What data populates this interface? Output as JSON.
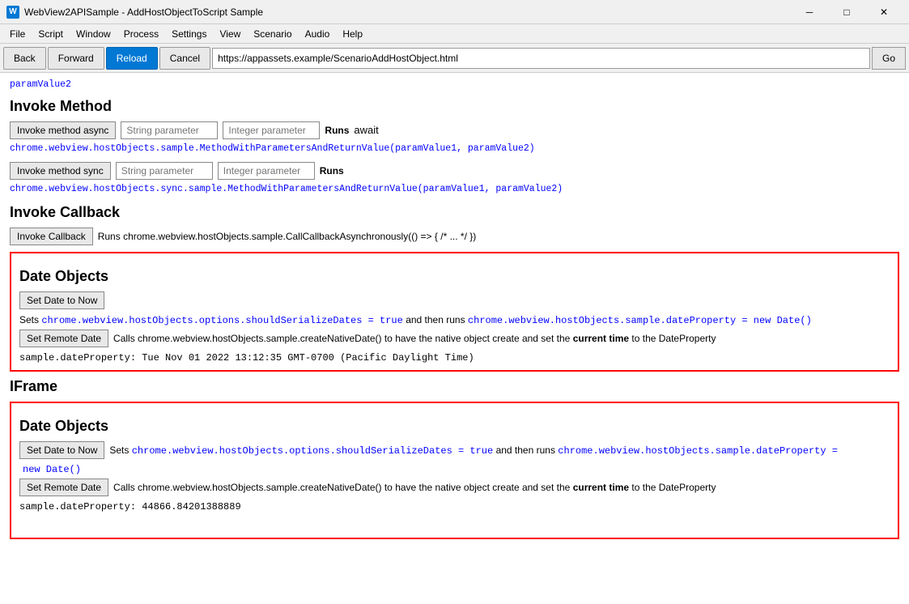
{
  "titlebar": {
    "title": "WebView2APISample - AddHostObjectToScript Sample",
    "icon_label": "W",
    "minimize_label": "─",
    "maximize_label": "□",
    "close_label": "✕"
  },
  "menubar": {
    "items": [
      "File",
      "Script",
      "Window",
      "Process",
      "Settings",
      "View",
      "Scenario",
      "Audio",
      "Help"
    ]
  },
  "toolbar": {
    "back_label": "Back",
    "forward_label": "Forward",
    "reload_label": "Reload",
    "cancel_label": "Cancel",
    "address": "https://appassets.example/ScenarioAddHostObject.html",
    "go_label": "Go"
  },
  "content": {
    "top_cut_text": "paramValue2",
    "invoke_method_title": "Invoke Method",
    "invoke_method_async_btn": "Invoke method async",
    "string_param_placeholder": "String parameter",
    "integer_param_placeholder": "Integer parameter",
    "runs_async_label": "Runs",
    "await_label": "await",
    "async_code": "chrome.webview.hostObjects.sample.MethodWithParametersAndReturnValue(paramValue1, paramValue2)",
    "invoke_method_sync_btn": "Invoke method sync",
    "runs_sync_label": "Runs",
    "sync_code": "chrome.webview.hostObjects.sync.sample.MethodWithParametersAndReturnValue(paramValue1, paramValue2)",
    "invoke_callback_title": "Invoke Callback",
    "invoke_callback_btn": "Invoke Callback",
    "callback_runs_text": "Runs chrome.webview.hostObjects.sample.CallCallbackAsynchronously(() => { /* ... */ })",
    "date_objects_title": "Date Objects",
    "set_date_btn": "Set Date to Now",
    "set_date_description_start": "Sets",
    "set_date_code1": "chrome.webview.hostObjects.options.shouldSerializeDates = true",
    "set_date_description_mid": "and then runs",
    "set_date_code2": "chrome.webview.hostObjects.sample.dateProperty = new Date()",
    "set_remote_btn": "Set Remote Date",
    "set_remote_description": "Calls chrome.webview.hostObjects.sample.createNativeDate() to have the native object create and set the",
    "set_remote_current": "current time",
    "set_remote_to": "to the DateProperty",
    "date_property_value": "sample.dateProperty: Tue Nov 01 2022 13:12:35 GMT-0700 (Pacific Daylight Time)",
    "iframe_title": "IFrame",
    "iframe_date_objects_title": "Date Objects",
    "iframe_set_date_btn": "Set Date to Now",
    "iframe_set_date_desc_start": "Sets",
    "iframe_set_date_code1": "chrome.webview.hostObjects.options.shouldSerializeDates = true",
    "iframe_set_date_desc_mid": "and then runs",
    "iframe_set_date_code2": "chrome.webview.hostObjects.sample.dateProperty =",
    "iframe_set_date_code3": "new Date()",
    "iframe_set_remote_btn": "Set Remote Date",
    "iframe_set_remote_desc": "Calls chrome.webview.hostObjects.sample.createNativeDate() to have the native object create and set the",
    "iframe_set_remote_current": "current time",
    "iframe_set_remote_to": "to the DateProperty",
    "iframe_date_property_value": "sample.dateProperty: 44866.84201388889"
  }
}
